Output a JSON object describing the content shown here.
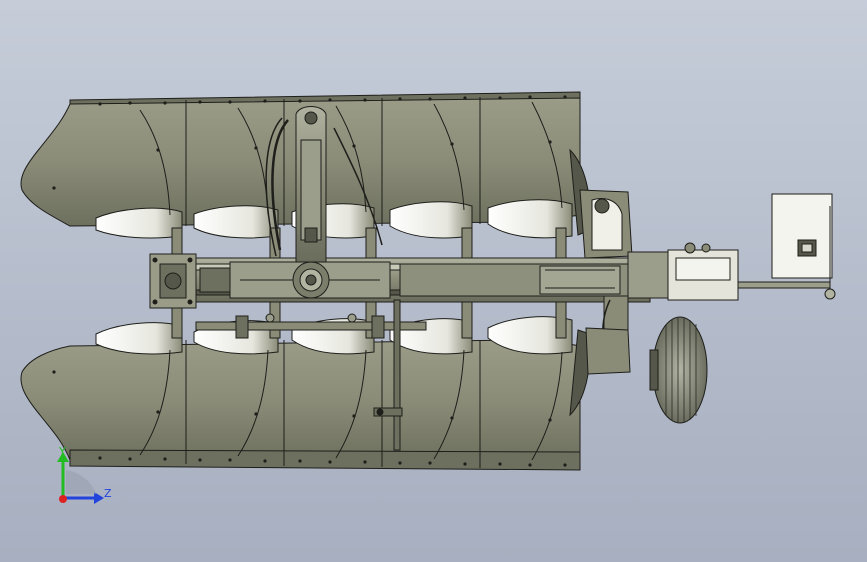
{
  "viewport": {
    "background_top": "#c6cdd9",
    "background_bottom": "#a7afc0"
  },
  "model": {
    "body_color": "#8a8c78",
    "body_dark": "#55574a",
    "edge_color": "#1e1e1a",
    "light_face": "#f4f4ee",
    "wheel_color": "#7c7e70"
  },
  "triad": {
    "y_label": "Y",
    "z_label": "Z",
    "y_color": "#22bb22",
    "z_color": "#2244dd",
    "x_color": "#dd2222"
  }
}
